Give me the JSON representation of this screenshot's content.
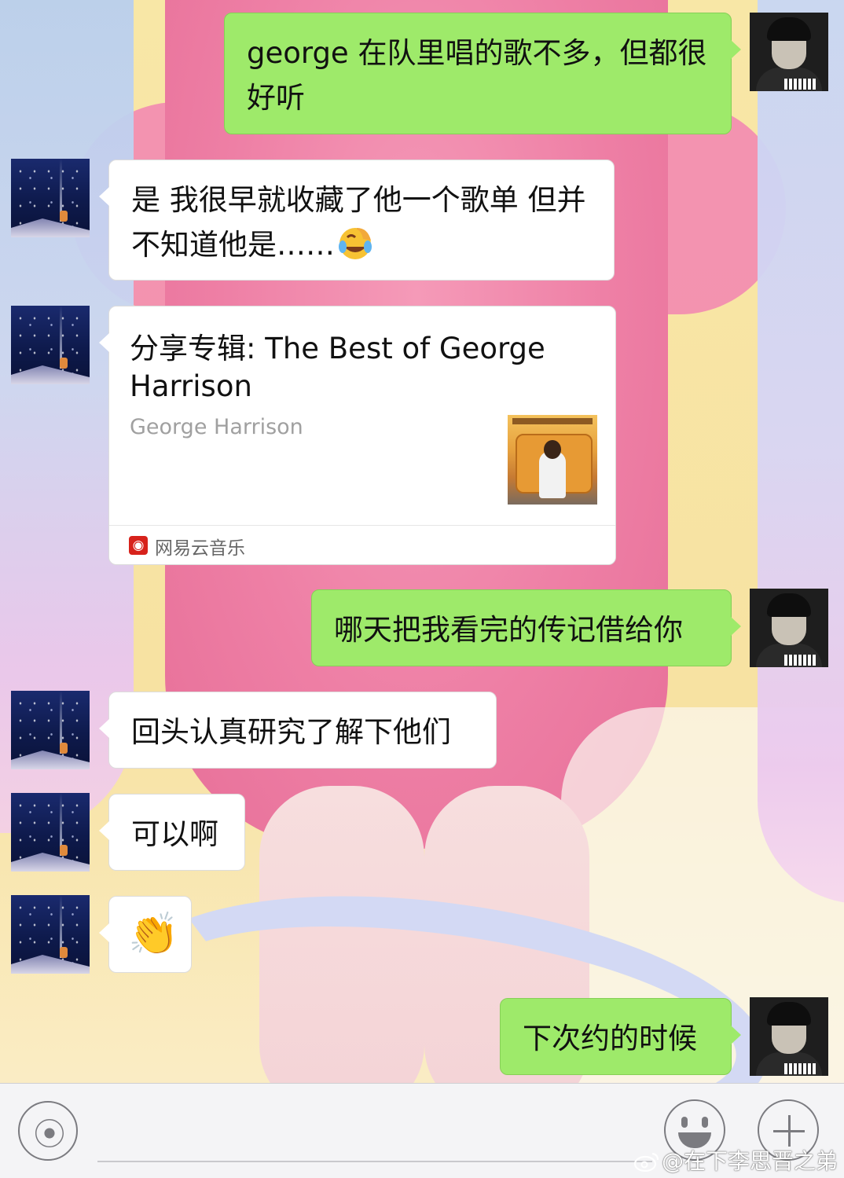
{
  "messages": [
    {
      "from": "me",
      "text": "george 在队里唱的歌不多，但都很好听"
    },
    {
      "from": "them",
      "text": "是 我很早就收藏了他一个歌单 但并不知道他是……"
    },
    {
      "from": "them",
      "type": "share",
      "title": "分享专辑: The Best of George Harrison",
      "artist": "George Harrison",
      "source": "网易云音乐"
    },
    {
      "from": "me",
      "text": "哪天把我看完的传记借给你"
    },
    {
      "from": "them",
      "text": "回头认真研究了解下他们"
    },
    {
      "from": "them",
      "text": "可以啊"
    },
    {
      "from": "them",
      "text": "👏"
    },
    {
      "from": "me",
      "text": "下次约的时候"
    }
  ],
  "emoji": {
    "msg2": "face-with-tears-of-joy-covering-face"
  },
  "input_bar": {
    "voice_icon": "voice-icon",
    "emoji_icon": "emoji-icon",
    "plus_icon": "plus-icon"
  },
  "watermark": "@在下李思晋之弟",
  "colors": {
    "me_bubble": "#9eea6a",
    "them_bubble": "#ffffff",
    "source_logo": "#d7221b"
  }
}
